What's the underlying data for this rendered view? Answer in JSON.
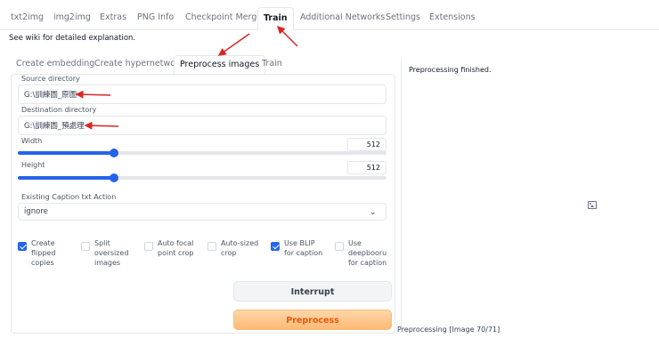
{
  "top_tabs": [
    {
      "label": "txt2img"
    },
    {
      "label": "img2img"
    },
    {
      "label": "Extras"
    },
    {
      "label": "PNG Info"
    },
    {
      "label": "Checkpoint Merger"
    },
    {
      "label": "Train"
    },
    {
      "label": "Additional Networks"
    },
    {
      "label": "Settings"
    },
    {
      "label": "Extensions"
    }
  ],
  "wiki_text": "See wiki for detailed explanation.",
  "sub_tabs": [
    {
      "label": "Create embedding"
    },
    {
      "label": "Create hypernetwork"
    },
    {
      "label": "Preprocess images"
    },
    {
      "label": "Train"
    }
  ],
  "source_directory": {
    "label": "Source directory",
    "value": "G:\\訓練圖_原圖"
  },
  "destination_directory": {
    "label": "Destination directory",
    "value": "G:\\訓練圖_預處理"
  },
  "width": {
    "label": "Width",
    "value": "512",
    "fraction": 0.26
  },
  "height": {
    "label": "Height",
    "value": "512",
    "fraction": 0.26
  },
  "caption_action": {
    "label": "Existing Caption txt Action",
    "value": "ignore"
  },
  "checkboxes": [
    {
      "label": "Create flipped copies",
      "checked": true
    },
    {
      "label": "Split oversized images",
      "checked": false
    },
    {
      "label": "Auto focal point crop",
      "checked": false
    },
    {
      "label": "Auto-sized crop",
      "checked": false
    },
    {
      "label": "Use BLIP for caption",
      "checked": true
    },
    {
      "label": "Use deepbooru for caption",
      "checked": false
    }
  ],
  "buttons": {
    "interrupt": "Interrupt",
    "preprocess": "Preprocess"
  },
  "output": {
    "status": "Preprocessing finished.",
    "progress": "Preprocessing [Image 70/71]",
    "placeholder_icon": "image-icon"
  },
  "colors": {
    "accent": "#2563eb",
    "primary_button": "#fdba74",
    "annotation_arrow": "#dc2626"
  }
}
